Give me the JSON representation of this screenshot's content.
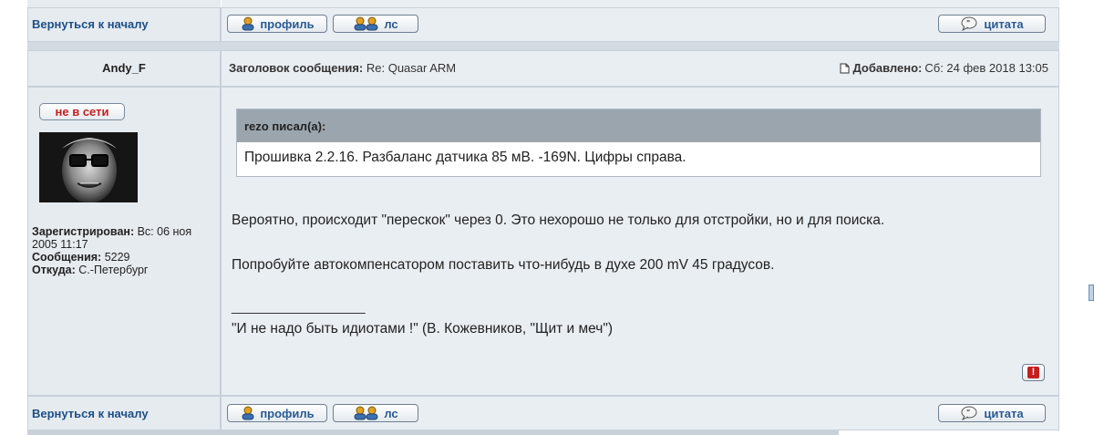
{
  "nav": {
    "back_to_top": "Вернуться к началу",
    "profile_btn": "профиль",
    "pm_btn": "лс",
    "quote_btn": "цитата"
  },
  "post": {
    "author": "Andy_F",
    "subject_label": "Заголовок сообщения:",
    "subject": "Re: Quasar ARM",
    "added_label": "Добавлено:",
    "added_value": "Сб: 24 фев 2018 13:05",
    "status": "не в сети",
    "profile": {
      "registered_label": "Зарегистрирован:",
      "registered_value": "Вс: 06 ноя 2005 11:17",
      "posts_label": "Сообщения:",
      "posts_value": "5229",
      "from_label": "Откуда:",
      "from_value": "С.-Петербург"
    },
    "quote": {
      "author_line": "rezo писал(а):",
      "text": "Прошивка 2.2.16. Разбаланс датчика 85 мВ. -169N. Цифры справа."
    },
    "body": [
      "Вероятно, происходит \"перескок\" через 0. Это нехорошо не только для отстройки, но и для поиска.",
      "Попробуйте автокомпенсатором поставить что-нибудь в духе 200 mV 45 градусов."
    ],
    "signature_rule": "_________________",
    "signature": "\"И не надо быть идиотами !\" (В. Кожевников, \"Щит и меч\")",
    "report_icon": "!"
  },
  "colors": {
    "cell_left": "#e6ebf0",
    "cell_right": "#e9eef3",
    "link": "#1d4f86",
    "offline_red": "#c41f1f",
    "quote_header": "#9ba5ae"
  }
}
